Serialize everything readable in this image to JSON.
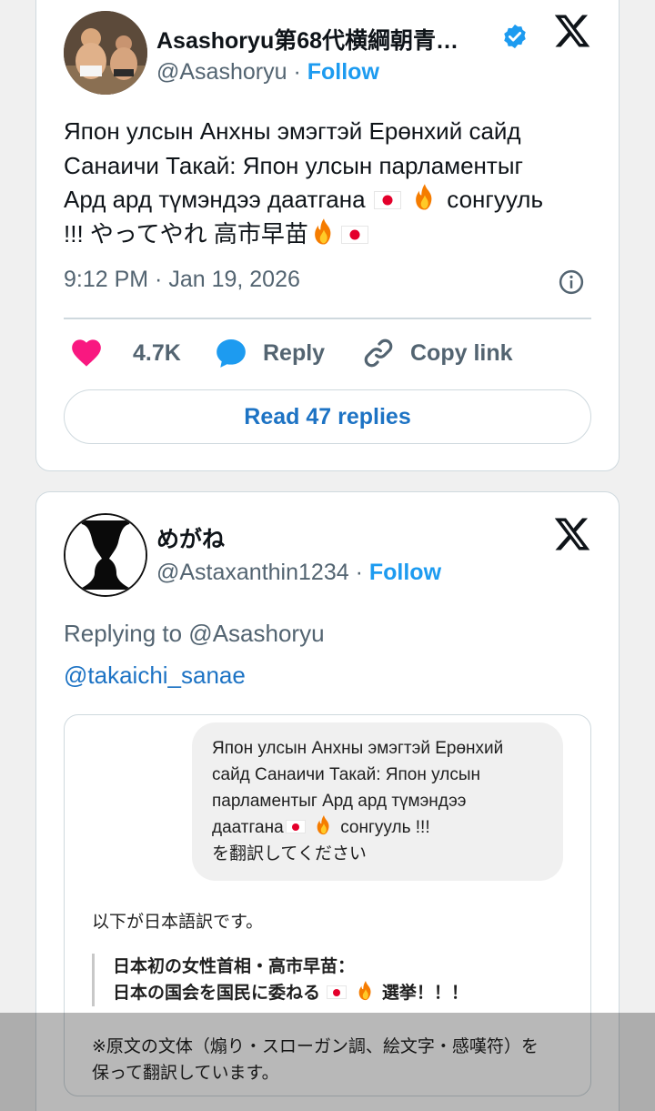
{
  "tweet1": {
    "author_name": "Asashoryu第68代横綱朝青…",
    "handle": "@Asashoryu",
    "separator": "·",
    "follow_label": "Follow",
    "text_lines": [
      "Япон улсын Анхны эмэгтэй Ерөнхий сайд",
      "Санаичи Такай: Япон улсын парламентыг",
      "Ард ард түмэндээ даатгана",
      "сонгууль",
      "!!! やってやれ 高市早苗"
    ],
    "timestamp": "9:12 PM · Jan 19, 2026",
    "likes_count": "4.7K",
    "reply_label": "Reply",
    "copy_link_label": "Copy link",
    "read_replies_label": "Read 47 replies"
  },
  "tweet2": {
    "author_name": "めがね",
    "handle": "@Astaxanthin1234",
    "separator": "·",
    "follow_label": "Follow",
    "replying_to": "Replying to @Asashoryu",
    "mention": "@takaichi_sanae",
    "screenshot": {
      "bubble_lines": [
        "Япон улсын Анхны эмэгтэй Ерөнхий",
        "сайд Санаичи Такай: Япон улсын",
        "парламентыг Ард ард түмэндээ",
        "даатгана",
        "сонгууль !!!",
        "を翻訳してください"
      ],
      "answer_intro": "以下が日本語訳です。",
      "quote_line1": "日本初の女性首相・高市早苗：",
      "quote_line2": "日本の国会を国民に委ねる",
      "quote_line2_end": "選挙！！！",
      "note_line1": "※原文の文体（煽り・スローガン調、絵文字・感嘆符）を",
      "note_line2": "保って翻訳しています。"
    }
  },
  "colors": {
    "accent_blue": "#1d9bf0",
    "link_blue": "#1d73c4",
    "heart_pink": "#f91880",
    "muted_text": "#536471",
    "border": "#cfd9de"
  },
  "icons": [
    "x-logo-icon",
    "verified-badge-icon",
    "info-icon",
    "heart-icon",
    "reply-bubble-icon",
    "link-icon",
    "japan-flag-icon",
    "fire-icon"
  ]
}
